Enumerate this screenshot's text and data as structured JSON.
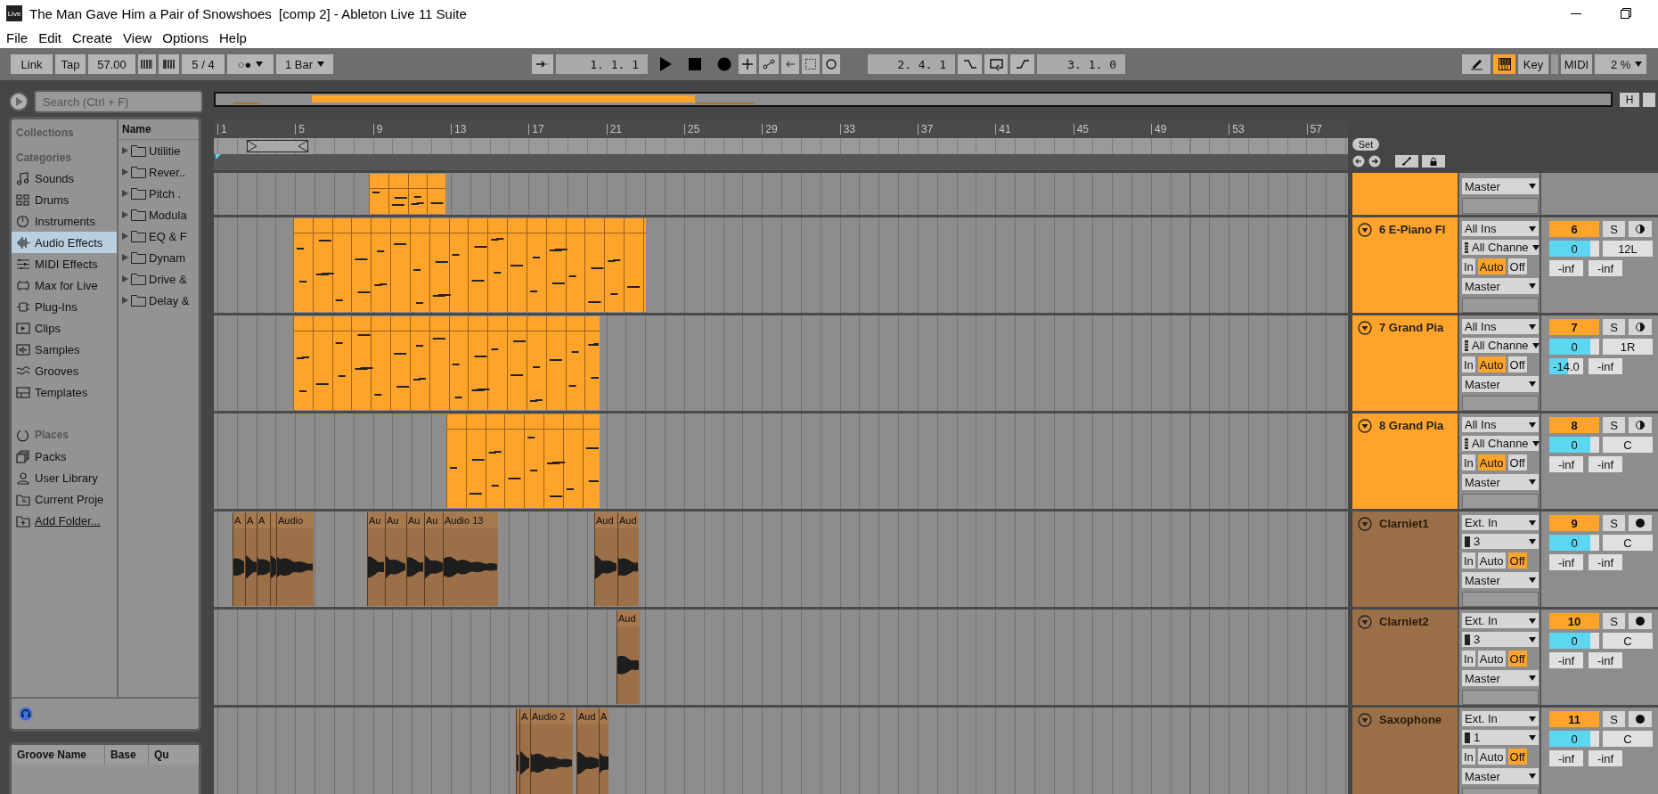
{
  "window": {
    "app_icon": "Live",
    "title": "The Man Gave Him a Pair of Snowshoes  [comp 2] - Ableton Live 11 Suite"
  },
  "menu": [
    "File",
    "Edit",
    "Create",
    "View",
    "Options",
    "Help"
  ],
  "toolbar": {
    "link": "Link",
    "tap": "Tap",
    "tempo": "57.00",
    "signature": "5 / 4",
    "metronome": "○●",
    "quantization": "1 Bar",
    "arrangement_position": "1. 1. 1",
    "loop_start": "2. 4. 1",
    "loop_length": "3. 1. 0",
    "midi_keyboard_on": true,
    "key": "Key",
    "midi": "MIDI",
    "cpu_load": "2 %"
  },
  "browser": {
    "search_placeholder": "Search (Ctrl + F)",
    "collections_label": "Collections",
    "categories_label": "Categories",
    "categories": [
      {
        "label": "Sounds",
        "selected": false
      },
      {
        "label": "Drums",
        "selected": false
      },
      {
        "label": "Instruments",
        "selected": false
      },
      {
        "label": "Audio Effects",
        "selected": true
      },
      {
        "label": "MIDI Effects",
        "selected": false
      },
      {
        "label": "Max for Live",
        "selected": false
      },
      {
        "label": "Plug-Ins",
        "selected": false
      },
      {
        "label": "Clips",
        "selected": false
      },
      {
        "label": "Samples",
        "selected": false
      },
      {
        "label": "Grooves",
        "selected": false
      },
      {
        "label": "Templates",
        "selected": false
      }
    ],
    "places_label": "Places",
    "places": [
      {
        "label": "Packs",
        "kind": "item"
      },
      {
        "label": "User Library",
        "kind": "item"
      },
      {
        "label": "Current Proje",
        "kind": "item"
      },
      {
        "label": "Add Folder...",
        "kind": "link"
      }
    ],
    "name_header": "Name",
    "folders": [
      "Utilitie",
      "Rever..",
      "Pitch .",
      "Modula",
      "EQ & F",
      "Dynam",
      "Drive &",
      "Delay &"
    ],
    "groove_pool": [
      "Groove Name",
      "Base",
      "Qu"
    ]
  },
  "arrangement": {
    "overview_buttons": [
      "H"
    ],
    "ruler": [
      "1",
      "5",
      "9",
      "13",
      "17",
      "21",
      "25",
      "29",
      "33",
      "37",
      "41",
      "45",
      "49",
      "53",
      "57"
    ],
    "set_button": "Set",
    "tracks": [
      {
        "kind": "midi",
        "color": "#ffa42b",
        "output": "Master",
        "clips": [
          {
            "kind": "midi"
          }
        ]
      },
      {
        "kind": "midi",
        "color": "#ffa42b",
        "name": "6 E-Piano Fl",
        "input_type": "All Ins",
        "input_channel": "All Channe",
        "monitor": [
          {
            "label": "In",
            "selected": false
          },
          {
            "label": "Auto",
            "selected": true
          },
          {
            "label": "Off",
            "selected": false
          }
        ],
        "output": "Master",
        "number": "6",
        "activator_on": true,
        "solo": "S",
        "volume": {
          "value": "0",
          "level": 0.82
        },
        "pan": "12L",
        "meters": [
          {
            "value": "-inf"
          },
          {
            "value": "-inf"
          }
        ],
        "clips": [
          {
            "kind": "midi"
          }
        ]
      },
      {
        "kind": "midi",
        "color": "#ffa42b",
        "name": "7 Grand Pia",
        "input_type": "All Ins",
        "input_channel": "All Channe",
        "monitor": [
          {
            "label": "In",
            "selected": false
          },
          {
            "label": "Auto",
            "selected": true
          },
          {
            "label": "Off",
            "selected": false
          }
        ],
        "output": "Master",
        "number": "7",
        "activator_on": true,
        "solo": "S",
        "volume": {
          "value": "0",
          "level": 0.82
        },
        "pan": "1R",
        "meters": [
          {
            "value": "-14.0",
            "level": 0.55
          },
          {
            "value": "-inf"
          }
        ],
        "clips": [
          {
            "kind": "midi"
          }
        ]
      },
      {
        "kind": "midi",
        "color": "#ffa42b",
        "name": "8 Grand Pia",
        "input_type": "All Ins",
        "input_channel": "All Channe",
        "monitor": [
          {
            "label": "In",
            "selected": false
          },
          {
            "label": "Auto",
            "selected": true
          },
          {
            "label": "Off",
            "selected": false
          }
        ],
        "output": "Master",
        "number": "8",
        "activator_on": true,
        "solo": "S",
        "volume": {
          "value": "0",
          "level": 0.82
        },
        "pan": "C",
        "meters": [
          {
            "value": "-inf"
          },
          {
            "value": "-inf"
          }
        ],
        "clips": [
          {
            "kind": "midi"
          }
        ]
      },
      {
        "kind": "audio",
        "color": "#9b7049",
        "name": "Clarniet1",
        "input_type": "Ext. In",
        "input_channel": "3",
        "monitor": [
          {
            "label": "In",
            "selected": false
          },
          {
            "label": "Auto",
            "selected": false
          },
          {
            "label": "Off",
            "selected": true
          }
        ],
        "output": "Master",
        "number": "9",
        "activator_on": true,
        "solo": "S",
        "volume": {
          "value": "0",
          "level": 0.82
        },
        "pan": "C",
        "meters": [
          {
            "value": "-inf"
          },
          {
            "value": "-inf"
          }
        ],
        "clips": [
          {
            "kind": "audio",
            "name": "A"
          },
          {
            "kind": "audio",
            "name": "A"
          },
          {
            "kind": "audio",
            "name": "A"
          },
          {
            "kind": "audio"
          },
          {
            "kind": "audio",
            "name": "Audio"
          },
          {
            "kind": "audio",
            "name": "Au"
          },
          {
            "kind": "audio",
            "name": "Au"
          },
          {
            "kind": "audio",
            "name": "Au"
          },
          {
            "kind": "audio",
            "name": "Au"
          },
          {
            "kind": "audio",
            "name": "Audio 13"
          },
          {
            "kind": "audio",
            "name": "Aud"
          },
          {
            "kind": "audio",
            "name": "Aud"
          }
        ]
      },
      {
        "kind": "audio",
        "color": "#9b7049",
        "name": "Clarniet2",
        "input_type": "Ext. In",
        "input_channel": "3",
        "monitor": [
          {
            "label": "In",
            "selected": false
          },
          {
            "label": "Auto",
            "selected": false
          },
          {
            "label": "Off",
            "selected": true
          }
        ],
        "output": "Master",
        "number": "10",
        "activator_on": true,
        "solo": "S",
        "volume": {
          "value": "0",
          "level": 0.82
        },
        "pan": "C",
        "meters": [
          {
            "value": "-inf"
          },
          {
            "value": "-inf"
          }
        ],
        "clips": [
          {
            "kind": "audio",
            "name": "Aud"
          }
        ]
      },
      {
        "kind": "audio",
        "color": "#9b7049",
        "name": "Saxophone",
        "input_type": "Ext. In",
        "input_channel": "1",
        "monitor": [
          {
            "label": "In",
            "selected": false
          },
          {
            "label": "Auto",
            "selected": false
          },
          {
            "label": "Off",
            "selected": true
          }
        ],
        "output": "Master",
        "number": "11",
        "activator_on": true,
        "solo": "S",
        "volume": {
          "value": "0",
          "level": 0.82
        },
        "pan": "C",
        "meters": [
          {
            "value": "-inf"
          },
          {
            "value": "-inf"
          }
        ],
        "clips": [
          {
            "kind": "audio"
          },
          {
            "kind": "audio",
            "name": "A"
          },
          {
            "kind": "audio",
            "name": "Audio 2"
          },
          {
            "kind": "audio",
            "name": "Aud"
          },
          {
            "kind": "audio",
            "name": "A"
          }
        ]
      }
    ]
  }
}
